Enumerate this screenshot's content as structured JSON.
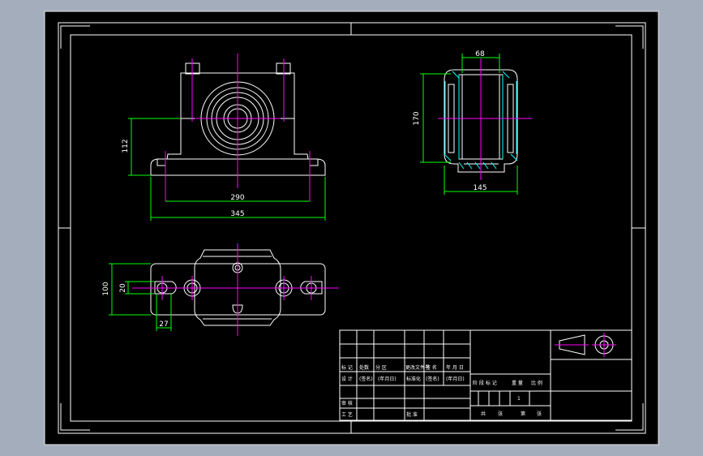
{
  "colors": {
    "background": "#a3adbb",
    "sheet": "#000000",
    "outline": "#ffffff",
    "dimension": "#00ff00",
    "centerline": "#ff00ff",
    "hatch": "#00ffff",
    "accent": "#ffff00"
  },
  "dimensions": {
    "front_height": "112",
    "front_bolt_spacing": "290",
    "front_total_width": "345",
    "side_width_top": "68",
    "side_height": "170",
    "side_width_bottom": "145",
    "top_depth": "100",
    "top_slot_width": "20",
    "top_slot_offset": "27"
  },
  "title_block": {
    "row1": [
      "标 记",
      "处数",
      "分  区",
      "更改文件号",
      "签 名",
      "年  月  日"
    ],
    "row2": [
      "设  计",
      "(签名)",
      "(年月日)",
      "标准化",
      "(签名)",
      "(年月日)"
    ],
    "row3": [
      "审  核"
    ],
    "row4": [
      "工  艺",
      "批  准"
    ],
    "stage_header": [
      "阶 段 标 记",
      "重 量",
      "比 例"
    ],
    "footer": [
      "共",
      "张",
      "第",
      "张"
    ],
    "scale_mark": "1"
  }
}
